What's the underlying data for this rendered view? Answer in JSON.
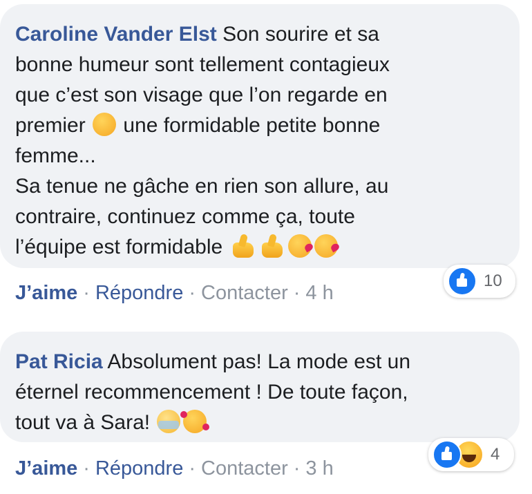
{
  "comments": [
    {
      "author": "Caroline Vander Elst",
      "lines": [
        " Son sourire et sa",
        "bonne humeur sont tellement contagieux",
        "que c’est son visage que l’on regarde en",
        "premier ",
        " une formidable petite bonne",
        "femme...",
        "Sa tenue ne gâche en rien son allure, au",
        "contraire, continuez comme ça, toute",
        "l’équipe est formidable "
      ],
      "emojis": [
        "winking-face",
        "thumbs-up",
        "thumbs-up",
        "face-blowing-kiss",
        "face-blowing-kiss"
      ],
      "actions": {
        "like": "J’aime",
        "reply": "Répondre",
        "contact": "Contacter",
        "time": "4 h",
        "separator": "·"
      },
      "reactions": {
        "icons": [
          "like"
        ],
        "count": "10"
      }
    },
    {
      "author": "Pat Ricia",
      "lines": [
        " Absolument pas! La mode est un",
        "éternel recommencement ! De toute façon,",
        "tout va à Sara! "
      ],
      "emojis": [
        "face-with-tears-of-joy-crying",
        "smiling-face-with-hearts"
      ],
      "actions": {
        "like": "J’aime",
        "reply": "Répondre",
        "contact": "Contacter",
        "time": "3 h",
        "separator": "·"
      },
      "reactions": {
        "icons": [
          "like",
          "haha"
        ],
        "count": "4"
      }
    }
  ],
  "colors": {
    "author": "#385898",
    "bubble": "#f0f2f5",
    "meta": "#8d949e",
    "like_blue": "#1877f2"
  }
}
